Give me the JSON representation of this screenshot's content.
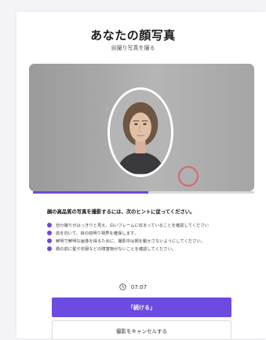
{
  "header": {
    "title": "あなたの顔写真",
    "subtitle": "自撮り写真を撮る"
  },
  "camera": {
    "progress_fraction": 0.52
  },
  "tips": {
    "heading": "顔の高品質の写真を撮影するには、次のヒントに従ってください。",
    "items": [
      "自分撮りがはっきりと見え、白いフレームに収まっていることを確認してください",
      "前を向いて、目の前明り視界を確保します。",
      "鮮明で鮮明な画像を得るために、撮影中は顔を動かさないようにしてください。",
      "顔の前に髪や衣服などの障害物がないことを確認してください。"
    ]
  },
  "timer": {
    "value": "07:07",
    "icon": "clock-icon"
  },
  "actions": {
    "continue_label": "「続ける」",
    "cancel_label": "撮影をキャンセルする"
  },
  "colors": {
    "accent": "#6d4be1",
    "record_ring": "#d9666c"
  }
}
